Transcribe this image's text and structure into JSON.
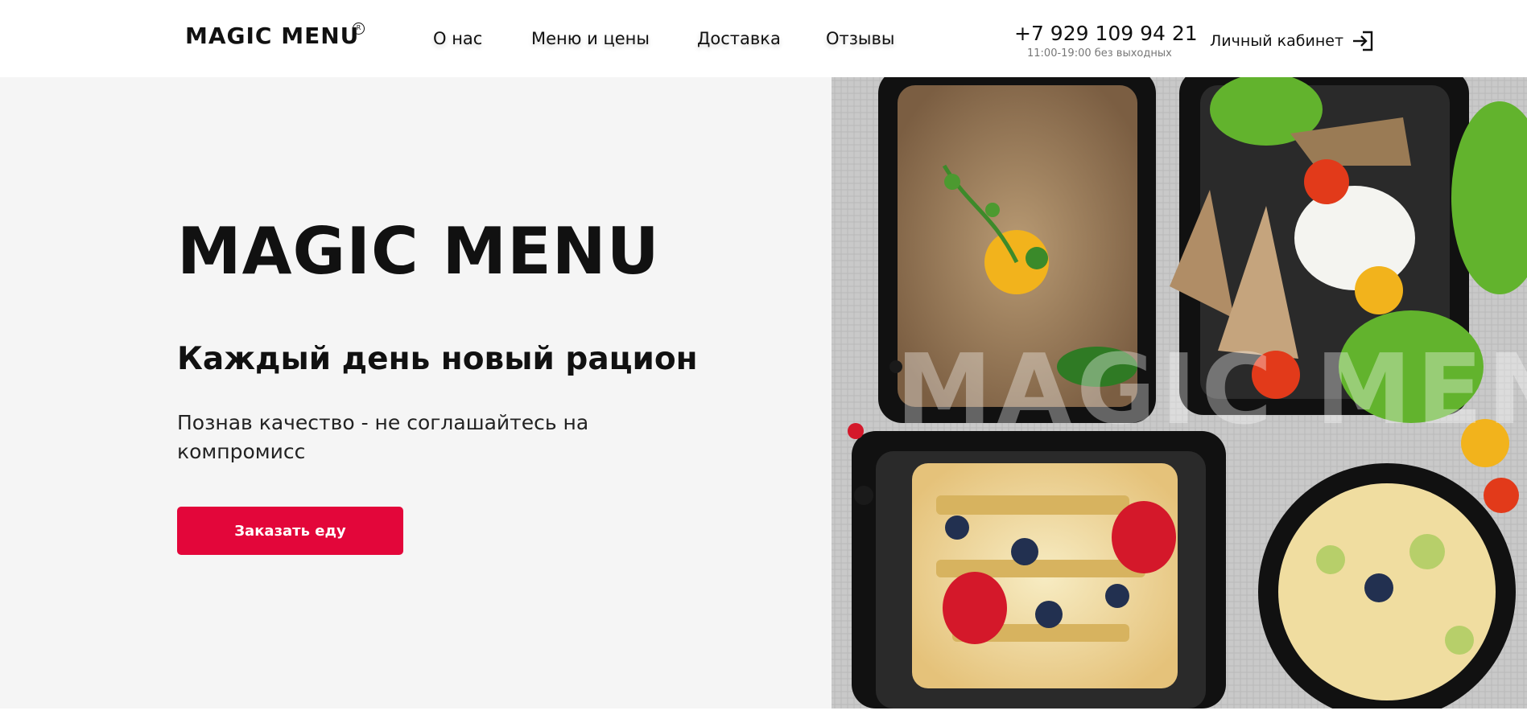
{
  "header": {
    "logo": "MAGIC MENU",
    "logo_reg": "R",
    "nav": [
      {
        "label": "О нас"
      },
      {
        "label": "Меню и цены"
      },
      {
        "label": "Доставка"
      },
      {
        "label": "Отзывы"
      }
    ],
    "phone": "+7 929 109 94 21",
    "hours": "11:00-19:00 без выходных",
    "cabinet_label": "Личный кабинет",
    "cabinet_icon": "login-icon"
  },
  "hero": {
    "title": "MAGIC MENU",
    "subtitle": "Каждый день новый рацион",
    "text": "Познав качество - не соглашайтесь на компромисс",
    "order_button": "Заказать еду",
    "image_watermark": "MAGIC MENU"
  },
  "colors": {
    "accent": "#e3063a",
    "hero_bg": "#f5f5f5",
    "header_bg": "#ffffff"
  }
}
